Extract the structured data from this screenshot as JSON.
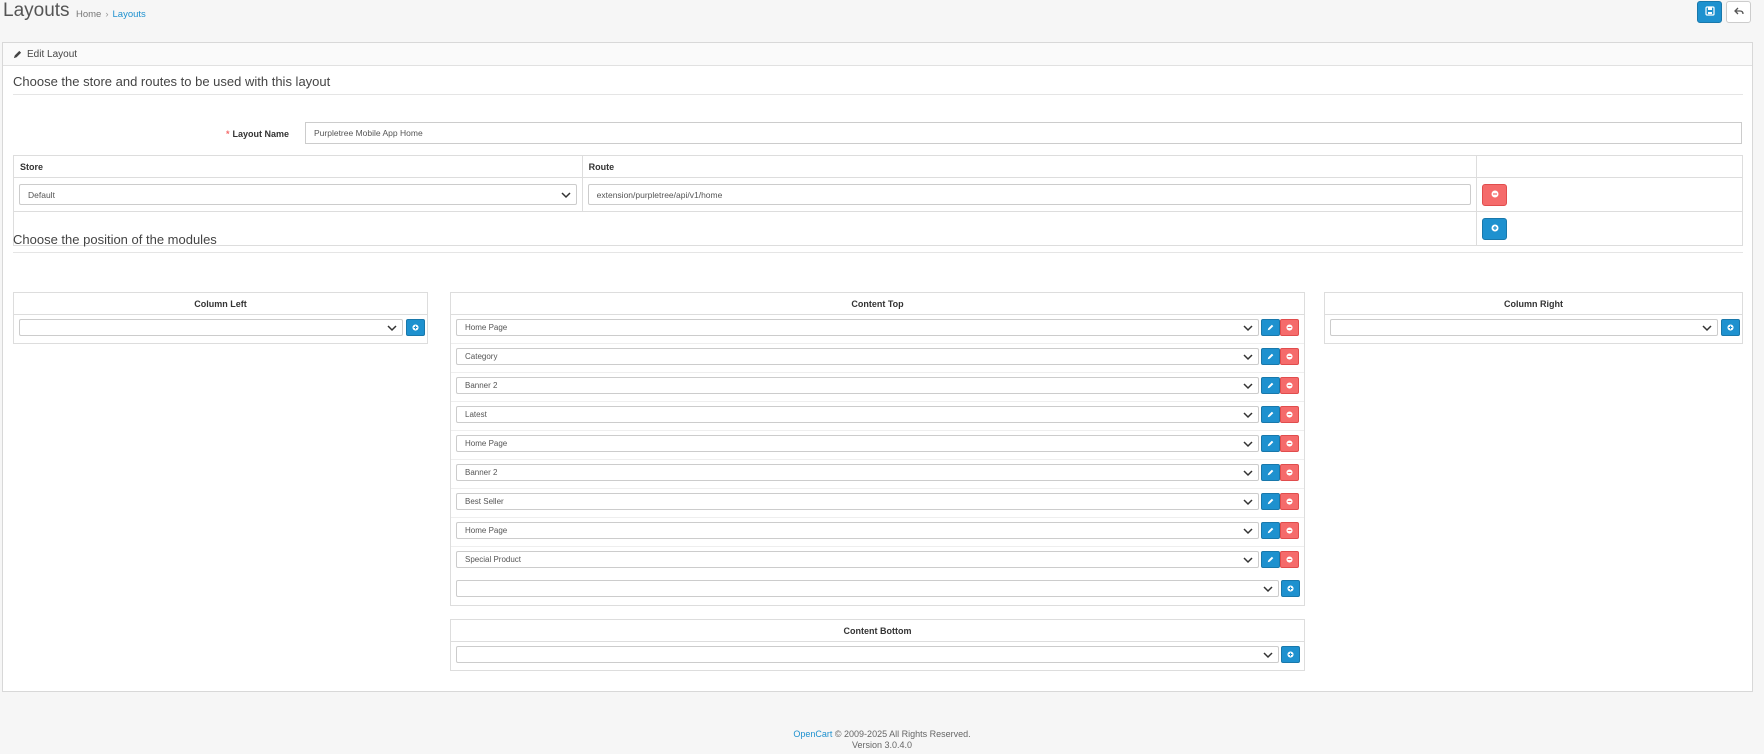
{
  "header": {
    "title": "Layouts",
    "breadcrumb": [
      "Home",
      "Layouts"
    ],
    "breadcrumb_sep": "›"
  },
  "panel": {
    "heading": "Edit Layout",
    "legend_routes": "Choose the store and routes to be used with this layout",
    "legend_modules": "Choose the position of the modules",
    "layout_name_label": "Layout Name",
    "required_mark": "*",
    "layout_name_value": "Purpletree Mobile App Home"
  },
  "route_table": {
    "headers": [
      "Store",
      "Route",
      ""
    ],
    "rows": [
      {
        "store": "Default",
        "route": "extension/purpletree/api/v1/home"
      }
    ]
  },
  "modules": {
    "column_left": {
      "title": "Column Left",
      "items": []
    },
    "content_top": {
      "title": "Content Top",
      "items": [
        "Home Page",
        "Category",
        "Banner 2",
        "Latest",
        "Home Page",
        "Banner 2",
        "Best Seller",
        "Home Page",
        "Special Product"
      ]
    },
    "column_right": {
      "title": "Column Right",
      "items": []
    },
    "content_bottom": {
      "title": "Content Bottom",
      "items": []
    }
  },
  "footer": {
    "brand": "OpenCart",
    "copyright": " © 2009-2025 All Rights Reserved.",
    "version": "Version 3.0.4.0"
  },
  "colors": {
    "primary": "#1e91cf",
    "danger": "#f56b6b"
  },
  "icons": {
    "save": "save-icon",
    "back": "reply-icon",
    "edit": "pencil-icon",
    "remove": "minus-circle-icon",
    "add": "plus-circle-icon",
    "dropdown": "chevron-down-icon"
  }
}
